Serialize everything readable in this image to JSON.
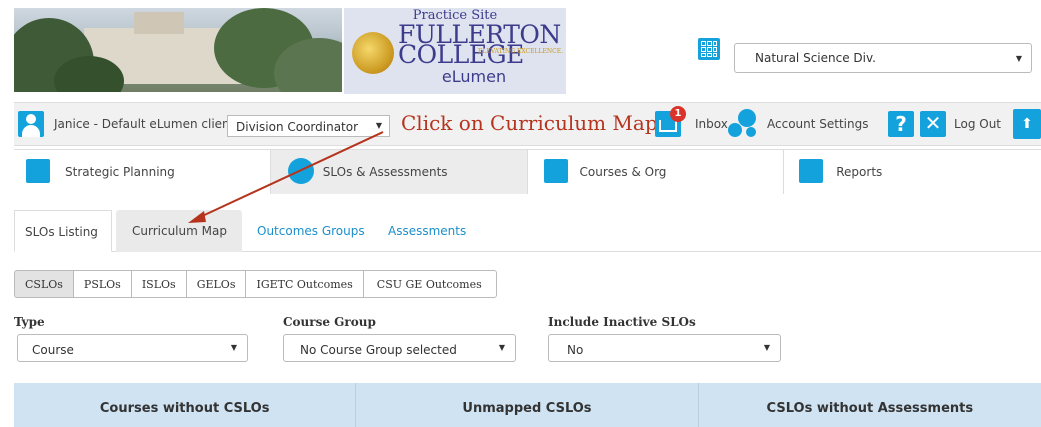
{
  "header": {
    "logo": {
      "site_label": "Practice Site",
      "name_line1": "FULLERTON",
      "name_line2": "COLLEGE",
      "tagline": "ELEVATING EXCELLENCE.",
      "product": "eLumen"
    },
    "division_select": {
      "value": "Natural Science Div."
    }
  },
  "topbar": {
    "user_name": "Janice - Default eLumen client",
    "role_select": {
      "value": "Division Coordinator"
    },
    "callout": "Click on Curriculum Map",
    "inbox_badge": "1",
    "inbox_label": "Inbox",
    "account_settings_label": "Account Settings",
    "help_glyph": "?",
    "logout_glyph": "✕",
    "logout_label": "Log Out"
  },
  "main_nav": [
    {
      "label": "Strategic Planning",
      "icon": "strategic-planning-icon"
    },
    {
      "label": "SLOs & Assessments",
      "icon": "slos-assessments-icon",
      "active": true
    },
    {
      "label": "Courses & Org",
      "icon": "courses-org-icon"
    },
    {
      "label": "Reports",
      "icon": "reports-icon"
    }
  ],
  "sub_tabs": [
    {
      "label": "SLOs Listing",
      "active": true
    },
    {
      "label": "Curriculum Map",
      "highlighted": true
    },
    {
      "label": "Outcomes Groups"
    },
    {
      "label": "Assessments"
    }
  ],
  "outcome_types": [
    "CSLOs",
    "PSLOs",
    "ISLOs",
    "GELOs",
    "IGETC Outcomes",
    "CSU GE Outcomes"
  ],
  "filters": {
    "type": {
      "label": "Type",
      "value": "Course"
    },
    "course_group": {
      "label": "Course Group",
      "value": "No Course Group selected"
    },
    "include_inactive": {
      "label": "Include Inactive SLOs",
      "value": "No"
    }
  },
  "table_headers": [
    "Courses without CSLOs",
    "Unmapped CSLOs",
    "CSLOs without Assessments"
  ],
  "colors": {
    "accent": "#14a2dd",
    "callout": "#b5341e",
    "table_header_bg": "#cfe3f2",
    "badge": "#d9332a"
  }
}
